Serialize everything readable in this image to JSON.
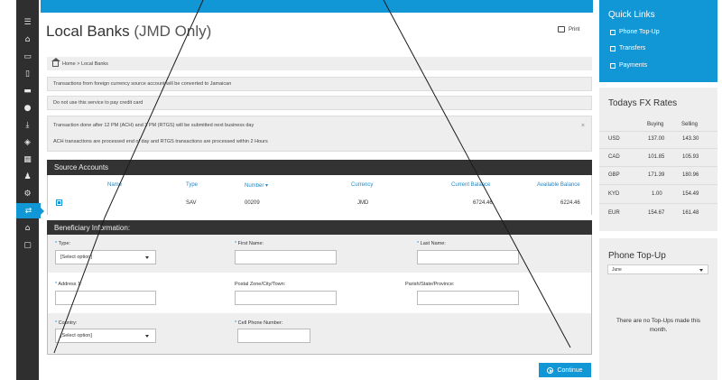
{
  "page": {
    "title_main": "Local Banks",
    "title_sub": "(JMD Only)",
    "print_label": "Print"
  },
  "breadcrumb": "Home > Local Banks",
  "notices": {
    "foreign_currency": "Transactions from foreign currency source account will be converted to Jamaican",
    "credit_card": "Do not use this service to pay credit card",
    "timing_line_1": "Transaction done after 12 PM (ACH) and 3 PM (RTGS) will be submitted next business day",
    "timing_line_2": "ACH transactions are processed end of day and RTGS transactions are processed within 2 Hours",
    "close_symbol": "×"
  },
  "source_accounts": {
    "title": "Source Accounts",
    "headers": {
      "name": "Name",
      "type": "Type",
      "number": "Number ▾",
      "currency": "Currency",
      "current_balance": "Current Balance",
      "available_balance": "Available Balance"
    },
    "rows": [
      {
        "type": "SAV",
        "number": "00209",
        "currency": "JMD",
        "current_balance": "6724.46",
        "available_balance": "6224.46"
      }
    ]
  },
  "beneficiary": {
    "title": "Beneficiary Information:",
    "req_mark": "*",
    "type_label": "Type:",
    "type_value": "[Select option]",
    "first_name_label": "First Name:",
    "last_name_label": "Last Name:",
    "address1_label": "Address 1:",
    "postal_label": "Postal Zone/City/Town:",
    "parish_label": "Parish/State/Province:",
    "country_label": "Country:",
    "country_value": "[Select option]",
    "cell_label": "Cell Phone Number:"
  },
  "continue_label": "Continue",
  "quick_links": {
    "title": "Quick Links",
    "items": [
      "Phone Top-Up",
      "Transfers",
      "Payments"
    ]
  },
  "fx": {
    "title": "Todays FX Rates",
    "buying_label": "Buying",
    "selling_label": "Selling",
    "rows": [
      {
        "currency": "USD",
        "buying": "137.00",
        "selling": "143.30"
      },
      {
        "currency": "CAD",
        "buying": "101.85",
        "selling": "105.93"
      },
      {
        "currency": "GBP",
        "buying": "171.39",
        "selling": "180.96"
      },
      {
        "currency": "KYD",
        "buying": "1.00",
        "selling": "154.49"
      },
      {
        "currency": "EUR",
        "buying": "154.67",
        "selling": "161.48"
      }
    ]
  },
  "phone_topup": {
    "title": "Phone Top-Up",
    "selected": "June",
    "empty_message": "There are no Top-Ups made this month."
  },
  "colors": {
    "accent": "#1196d6",
    "dark_header": "#333333",
    "rail": "#2f2f2f",
    "panel_grey": "#eeeeee"
  },
  "rail_icons": [
    "menu-icon",
    "home-icon",
    "monitor-icon",
    "mobile-icon",
    "card-icon",
    "user-icon",
    "download-icon",
    "money-icon",
    "calculator-icon",
    "users-icon",
    "settings-icon",
    "transfer-icon",
    "bank-icon",
    "message-icon"
  ]
}
